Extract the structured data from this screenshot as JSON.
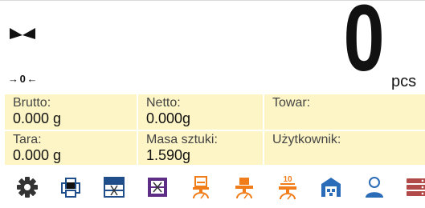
{
  "display": {
    "value": "0",
    "unit": "pcs",
    "zero_indicator": "→ 0 ←",
    "stability_icon": "bowtie-stable-icon"
  },
  "info": {
    "brutto": {
      "label": "Brutto:",
      "value": "0.000 g"
    },
    "netto": {
      "label": "Netto:",
      "value": "0.000g"
    },
    "towar": {
      "label": "Towar:",
      "value": ""
    },
    "tara": {
      "label": "Tara:",
      "value": "0.000 g"
    },
    "masa_sztuki": {
      "label": "Masa sztuki:",
      "value": "1.590g"
    },
    "uzytkownik": {
      "label": "Użytkownik:",
      "value": ""
    }
  },
  "toolbar": {
    "items": [
      {
        "name": "settings",
        "icon": "gear-icon"
      },
      {
        "name": "printout",
        "icon": "printer-icon"
      },
      {
        "name": "table-x",
        "icon": "table-x-icon"
      },
      {
        "name": "table-x-highlight",
        "icon": "table-x-purple-icon"
      },
      {
        "name": "sample-weigh",
        "icon": "weigh-pan-icon"
      },
      {
        "name": "tare-weigh",
        "icon": "weigh-pan-orange-icon"
      },
      {
        "name": "reference-10",
        "icon": "reference-sample-icon",
        "label": "10"
      },
      {
        "name": "warehouse",
        "icon": "warehouse-icon"
      },
      {
        "name": "operator",
        "icon": "user-icon"
      },
      {
        "name": "database",
        "icon": "database-icon"
      }
    ]
  },
  "colors": {
    "info_bg": "#fdf5c6",
    "accent_orange": "#f07d1a",
    "accent_purple": "#5e2e86",
    "accent_blue": "#2a6cb7"
  }
}
